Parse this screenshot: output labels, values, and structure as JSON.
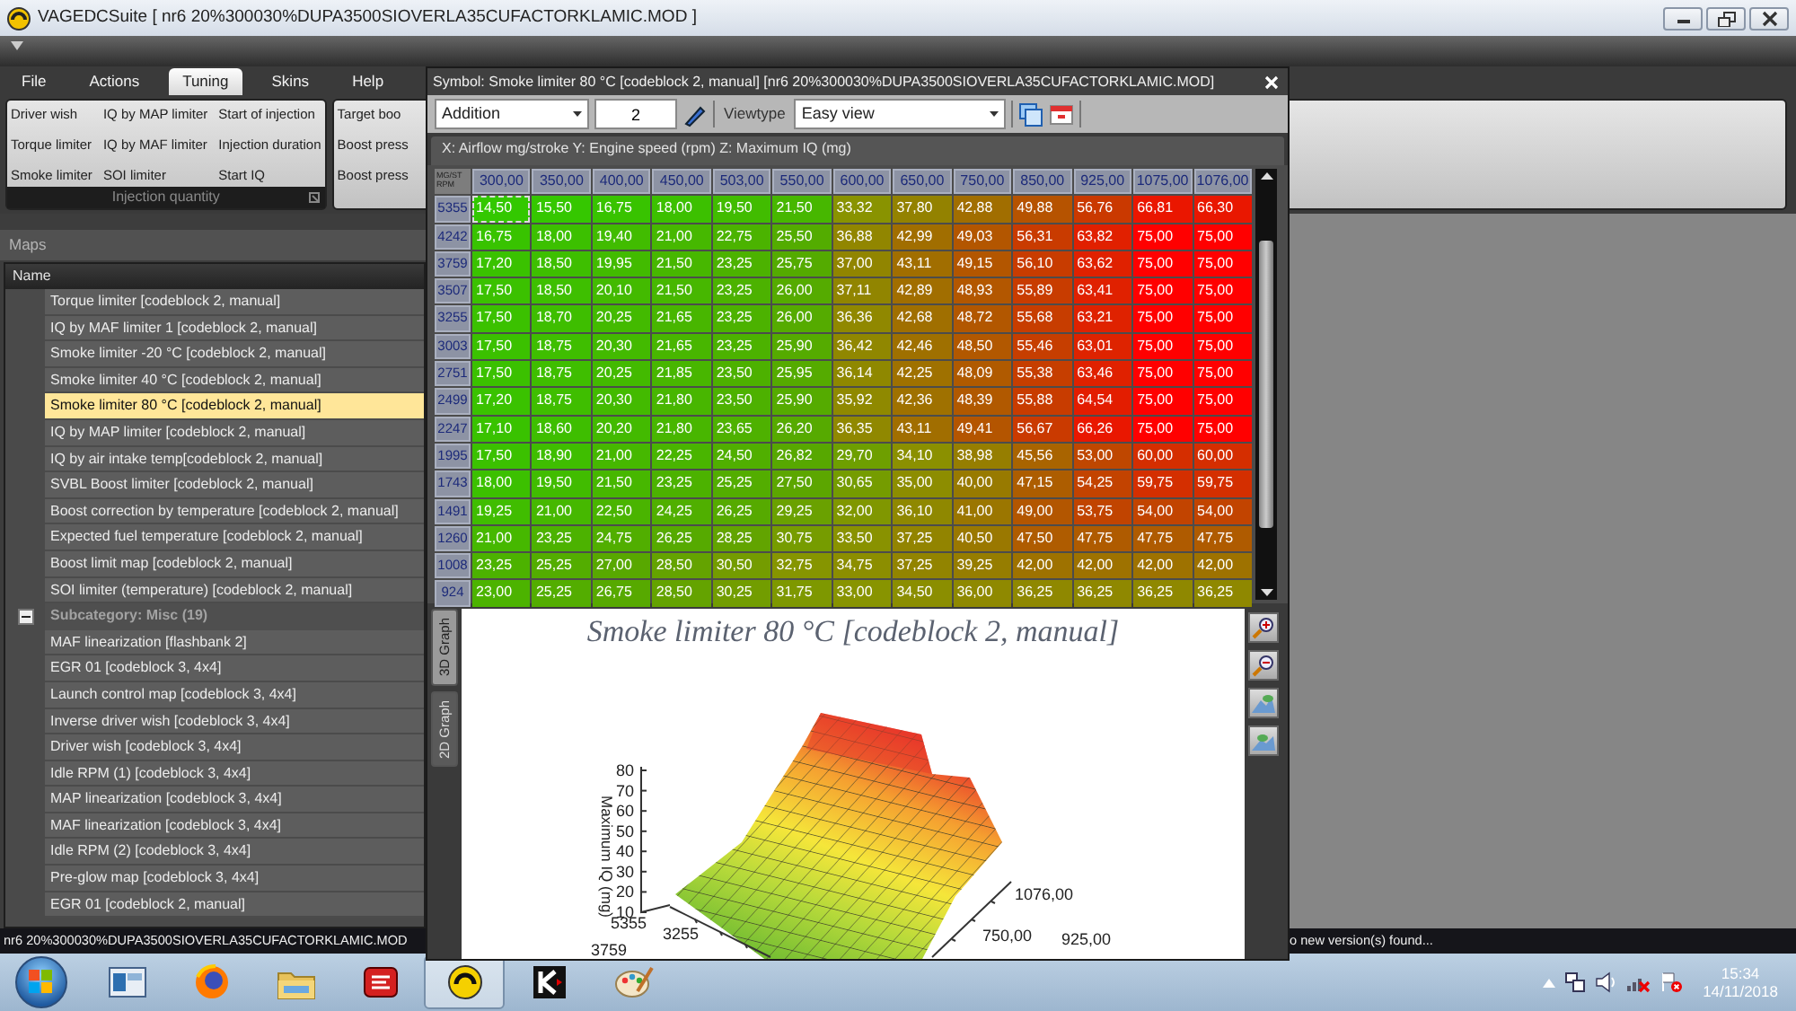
{
  "window": {
    "title": "VAGEDCSuite [ nr6 20%300030%DUPA3500SIOVERLA35CUFACTORKLAMIC.MOD ]"
  },
  "menu_tabs": [
    {
      "label": "File",
      "selected": false
    },
    {
      "label": "Actions",
      "selected": false
    },
    {
      "label": "Tuning",
      "selected": true
    },
    {
      "label": "Skins",
      "selected": false
    },
    {
      "label": "Help",
      "selected": false
    }
  ],
  "ribbon": {
    "groups": [
      {
        "caption": "Injection quantity",
        "columns": [
          [
            "Driver wish",
            "Torque limiter",
            "Smoke limiter"
          ],
          [
            "IQ by MAP limiter",
            "IQ by MAF limiter",
            "SOI limiter"
          ],
          [
            "Start of injection",
            "Injection duration",
            "Start IQ"
          ]
        ]
      },
      {
        "columns": [
          [
            "Target boo",
            "Boost press",
            "Boost press"
          ]
        ]
      }
    ]
  },
  "maps_panel": {
    "title": "Maps",
    "column": "Name",
    "groups": [
      {
        "items": [
          {
            "label": "Torque limiter [codeblock 2, manual]",
            "selected": false
          },
          {
            "label": "IQ by MAF limiter 1 [codeblock 2, manual]",
            "selected": false
          },
          {
            "label": "Smoke limiter -20 °C [codeblock 2, manual]",
            "selected": false
          },
          {
            "label": "Smoke limiter 40 °C [codeblock 2, manual]",
            "selected": false
          },
          {
            "label": "Smoke limiter 80 °C [codeblock 2, manual]",
            "selected": true
          },
          {
            "label": "IQ by MAP limiter [codeblock 2, manual]",
            "selected": false
          },
          {
            "label": "IQ by air intake temp[codeblock 2, manual]",
            "selected": false
          },
          {
            "label": "SVBL Boost limiter [codeblock 2, manual]",
            "selected": false
          },
          {
            "label": "Boost correction by temperature [codeblock 2, manual]",
            "selected": false
          },
          {
            "label": "Expected fuel temperature [codeblock 2, manual]",
            "selected": false
          },
          {
            "label": "Boost limit map [codeblock 2, manual]",
            "selected": false
          },
          {
            "label": "SOI limiter (temperature) [codeblock 2, manual]",
            "selected": false
          }
        ]
      },
      {
        "header": "Subcategory: Misc (19)",
        "expanded": true,
        "items": [
          {
            "label": "MAF linearization [flashbank 2]",
            "selected": false
          },
          {
            "label": "EGR 01 [codeblock 3, 4x4]",
            "selected": false
          },
          {
            "label": "Launch control map [codeblock 3, 4x4]",
            "selected": false
          },
          {
            "label": "Inverse driver wish [codeblock 3, 4x4]",
            "selected": false
          },
          {
            "label": "Driver wish [codeblock 3, 4x4]",
            "selected": false
          },
          {
            "label": "Idle RPM (1) [codeblock 3, 4x4]",
            "selected": false
          },
          {
            "label": "MAP linearization [codeblock 3, 4x4]",
            "selected": false
          },
          {
            "label": "MAF linearization [codeblock 3, 4x4]",
            "selected": false
          },
          {
            "label": "Idle RPM (2) [codeblock 3, 4x4]",
            "selected": false
          },
          {
            "label": "Pre-glow map [codeblock 3, 4x4]",
            "selected": false
          },
          {
            "label": "EGR 01 [codeblock 2, manual]",
            "selected": false
          }
        ]
      }
    ]
  },
  "symbol_window": {
    "title": "Symbol: Smoke limiter 80 °C [codeblock 2, manual] [nr6 20%300030%DUPA3500SIOVERLA35CUFACTORKLAMIC.MOD]",
    "toolbar": {
      "operation": "Addition",
      "amount": "2",
      "viewtype_label": "Viewtype",
      "viewtype": "Easy view"
    },
    "axes_caption": "X: Airflow mg/stroke Y: Engine speed (rpm) Z: Maximum IQ (mg)",
    "table": {
      "corner": [
        "MG/ST",
        "RPM"
      ],
      "columns": [
        "300,00",
        "350,00",
        "400,00",
        "450,00",
        "503,00",
        "550,00",
        "600,00",
        "650,00",
        "750,00",
        "850,00",
        "925,00",
        "1075,00",
        "1076,00"
      ],
      "rows": [
        {
          "rpm": "5355",
          "cells": [
            "14,50",
            "15,50",
            "16,75",
            "18,00",
            "19,50",
            "21,50",
            "33,32",
            "37,80",
            "42,88",
            "49,88",
            "56,76",
            "66,81",
            "66,30"
          ]
        },
        {
          "rpm": "4242",
          "cells": [
            "16,75",
            "18,00",
            "19,40",
            "21,00",
            "22,75",
            "25,50",
            "36,88",
            "42,99",
            "49,03",
            "56,31",
            "63,82",
            "75,00",
            "75,00"
          ]
        },
        {
          "rpm": "3759",
          "cells": [
            "17,20",
            "18,50",
            "19,95",
            "21,50",
            "23,25",
            "25,75",
            "37,00",
            "43,11",
            "49,15",
            "56,10",
            "63,62",
            "75,00",
            "75,00"
          ]
        },
        {
          "rpm": "3507",
          "cells": [
            "17,50",
            "18,50",
            "20,10",
            "21,50",
            "23,25",
            "26,00",
            "37,11",
            "42,89",
            "48,93",
            "55,89",
            "63,41",
            "75,00",
            "75,00"
          ]
        },
        {
          "rpm": "3255",
          "cells": [
            "17,50",
            "18,70",
            "20,25",
            "21,65",
            "23,25",
            "26,00",
            "36,36",
            "42,68",
            "48,72",
            "55,68",
            "63,21",
            "75,00",
            "75,00"
          ]
        },
        {
          "rpm": "3003",
          "cells": [
            "17,50",
            "18,75",
            "20,30",
            "21,65",
            "23,25",
            "25,90",
            "36,42",
            "42,46",
            "48,50",
            "55,46",
            "63,01",
            "75,00",
            "75,00"
          ]
        },
        {
          "rpm": "2751",
          "cells": [
            "17,50",
            "18,75",
            "20,25",
            "21,85",
            "23,50",
            "25,95",
            "36,14",
            "42,25",
            "48,09",
            "55,38",
            "63,46",
            "75,00",
            "75,00"
          ]
        },
        {
          "rpm": "2499",
          "cells": [
            "17,20",
            "18,75",
            "20,30",
            "21,80",
            "23,50",
            "25,90",
            "35,92",
            "42,36",
            "48,39",
            "55,88",
            "64,54",
            "75,00",
            "75,00"
          ]
        },
        {
          "rpm": "2247",
          "cells": [
            "17,10",
            "18,60",
            "20,20",
            "21,80",
            "23,65",
            "26,20",
            "36,35",
            "43,11",
            "49,41",
            "56,67",
            "66,26",
            "75,00",
            "75,00"
          ]
        },
        {
          "rpm": "1995",
          "cells": [
            "17,50",
            "18,90",
            "21,00",
            "22,25",
            "24,50",
            "26,82",
            "29,70",
            "34,10",
            "38,98",
            "45,56",
            "53,00",
            "60,00",
            "60,00"
          ]
        },
        {
          "rpm": "1743",
          "cells": [
            "18,00",
            "19,50",
            "21,50",
            "23,25",
            "25,25",
            "27,50",
            "30,65",
            "35,00",
            "40,00",
            "47,15",
            "54,25",
            "59,75",
            "59,75"
          ]
        },
        {
          "rpm": "1491",
          "cells": [
            "19,25",
            "21,00",
            "22,50",
            "24,25",
            "26,25",
            "29,25",
            "32,00",
            "36,10",
            "41,00",
            "49,00",
            "53,75",
            "54,00",
            "54,00"
          ]
        },
        {
          "rpm": "1260",
          "cells": [
            "21,00",
            "23,25",
            "24,75",
            "26,25",
            "28,25",
            "30,75",
            "33,50",
            "37,25",
            "40,50",
            "47,50",
            "47,75",
            "47,75",
            "47,75"
          ]
        },
        {
          "rpm": "1008",
          "cells": [
            "23,25",
            "25,25",
            "27,00",
            "28,50",
            "30,50",
            "32,75",
            "34,75",
            "37,25",
            "39,25",
            "42,00",
            "42,00",
            "42,00",
            "42,00"
          ]
        },
        {
          "rpm": "924",
          "cells": [
            "23,00",
            "25,25",
            "26,75",
            "28,50",
            "30,25",
            "31,75",
            "33,00",
            "34,50",
            "36,00",
            "36,25",
            "36,25",
            "36,25",
            "36,25"
          ]
        }
      ]
    },
    "graph": {
      "tabs": [
        {
          "label": "3D Graph",
          "selected": true
        },
        {
          "label": "2D Graph",
          "selected": false
        }
      ],
      "title": "Smoke limiter 80 °C [codeblock 2, manual]",
      "z_label": "Maximum IQ (mg)",
      "z_ticks": [
        "80",
        "70",
        "60",
        "50",
        "40",
        "30",
        "20",
        "10"
      ],
      "y_ticks": [
        "5355",
        "3255",
        "3759"
      ],
      "x_ticks": [
        "1076,00",
        "750,00",
        "925,00"
      ]
    }
  },
  "status_bar": {
    "left": "nr6 20%300030%DUPA3500SIOVERLA35CUFACTORKLAMIC.MOD",
    "right": "o new version(s) found..."
  },
  "taskbar": {
    "apps": [
      {
        "kind": "window",
        "selected": false
      },
      {
        "kind": "globe",
        "selected": false
      },
      {
        "kind": "folder",
        "selected": false
      },
      {
        "kind": "red-app",
        "selected": false
      },
      {
        "kind": "gauge",
        "selected": true
      },
      {
        "kind": "k-app",
        "selected": false
      },
      {
        "kind": "palette",
        "selected": false
      }
    ],
    "time": "15:34",
    "date": "14/11/2018"
  }
}
